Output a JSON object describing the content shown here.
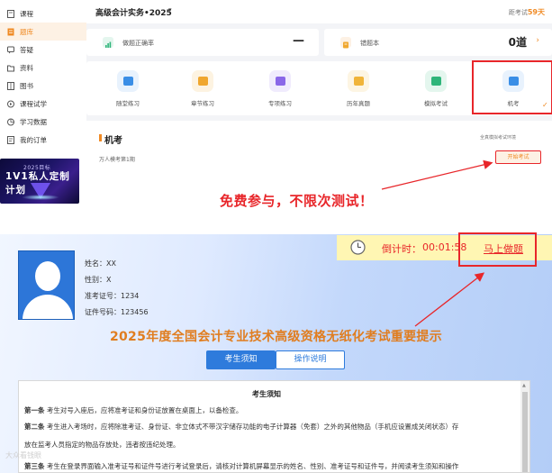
{
  "sidebar": {
    "items": [
      {
        "label": "课程",
        "icon": "book-icon"
      },
      {
        "label": "题库",
        "icon": "question-bank-icon",
        "active": true
      },
      {
        "label": "答疑",
        "icon": "chat-icon"
      },
      {
        "label": "资料",
        "icon": "folder-icon"
      },
      {
        "label": "图书",
        "icon": "bookshelf-icon"
      },
      {
        "label": "课程试学",
        "icon": "play-icon"
      },
      {
        "label": "学习数据",
        "icon": "data-icon"
      },
      {
        "label": "我的订单",
        "icon": "order-icon"
      }
    ],
    "promo": {
      "line1": "2025目标",
      "line2": "1V1私人定制计划"
    }
  },
  "header": {
    "course_title": "高级会计实务•2025",
    "caret": "▾",
    "countdown_prefix": "距考试",
    "countdown_days": "59",
    "countdown_suffix": "天"
  },
  "stats": {
    "rate_label": "做题正确率",
    "rate_value": "—",
    "wrong_label": "错题本",
    "wrong_value": "0道",
    "wrong_arrow": "›"
  },
  "modes": [
    {
      "label": "随堂练习",
      "color": "#3a8ee6",
      "bg": "#e8f2fd"
    },
    {
      "label": "章节练习",
      "color": "#f0a72f",
      "bg": "#fdf3e1"
    },
    {
      "label": "专项练习",
      "color": "#8a67e8",
      "bg": "#f0ebfd"
    },
    {
      "label": "历年真题",
      "color": "#f0b43a",
      "bg": "#fdf5e3"
    },
    {
      "label": "模拟考试",
      "color": "#2fb57a",
      "bg": "#e4f6ee"
    },
    {
      "label": "机考",
      "color": "#3a8ee6",
      "bg": "#e8f2fd"
    }
  ],
  "exam_panel": {
    "title": "机考",
    "subtitle": "万人模考第1期",
    "env_label": "全真模拟考试环境",
    "start_label": "开始考试"
  },
  "annotation": {
    "free_text": "免费参与，不限次测试！"
  },
  "candidate": {
    "name": "姓名：XX",
    "gender": "性别：X",
    "ticket": "准考证号：1234",
    "id": "证件号码：123456"
  },
  "timer": {
    "label": "倒计时：",
    "value": "00:01:58",
    "start_link": "马上做题"
  },
  "notice": {
    "main_title": "2025年度全国会计专业技术高级资格无纸化考试重要提示",
    "tab_active": "考生须知",
    "tab_other": "操作说明",
    "box_title": "考生须知",
    "rules": [
      {
        "num": "第一条",
        "text": " 考生对号入座后，应将准考证和身份证放置在桌面上，以备检查。"
      },
      {
        "num": "第二条",
        "text": " 考生进入考场时，应将除准考证、身份证、非立体式不带汉字储存功能的电子计算器（免套）之外的其他物品（手机应设置成关闭状态）存"
      },
      {
        "num": "",
        "text": "放在监考人员指定的物品存放处，违者按违纪处理。"
      },
      {
        "num": "第三条",
        "text": " 考生在登录界面输入准考证号和证件号进行考试登录后，请核对计算机屏幕显示的姓名、性别、准考证号和证件号，并阅读考生须知和操作"
      }
    ]
  },
  "watermark": "大众看钱眼"
}
